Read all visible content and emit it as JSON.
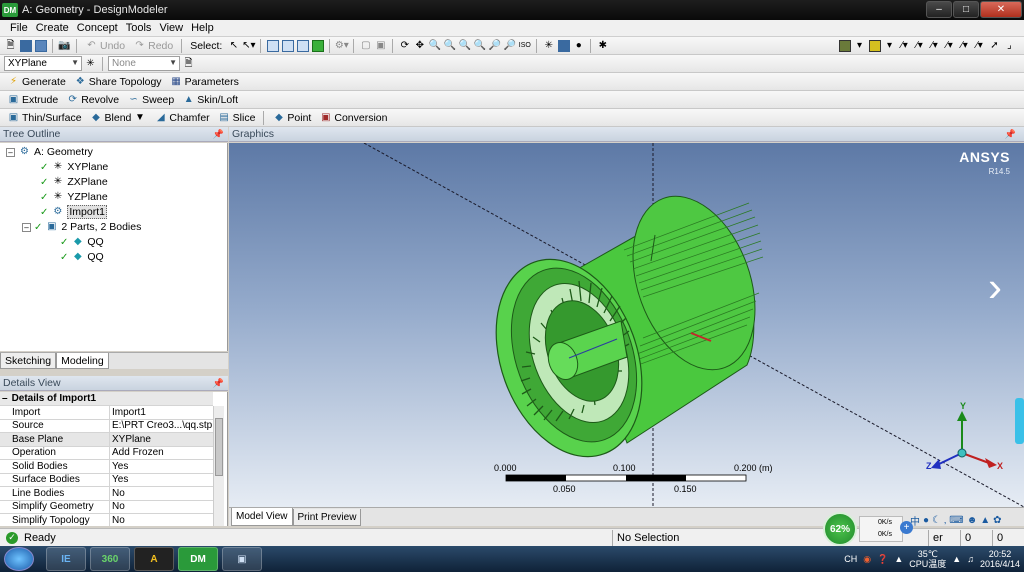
{
  "window": {
    "title": "A: Geometry - DesignModeler",
    "logo": "DM",
    "controls": [
      "–",
      "□",
      "✕"
    ]
  },
  "menu": [
    "File",
    "Create",
    "Concept",
    "Tools",
    "View",
    "Help"
  ],
  "toolbar1": {
    "undo": "Undo",
    "redo": "Redo",
    "select_label": "Select:"
  },
  "toolbar2": {
    "plane_combo": "XYPlane",
    "sketch_combo": "None"
  },
  "toolbar3": {
    "generate": "Generate",
    "share_topology": "Share Topology",
    "parameters": "Parameters"
  },
  "toolbar4": {
    "extrude": "Extrude",
    "revolve": "Revolve",
    "sweep": "Sweep",
    "skin_loft": "Skin/Loft"
  },
  "toolbar5": {
    "thin_surface": "Thin/Surface",
    "blend": "Blend",
    "chamfer": "Chamfer",
    "slice": "Slice",
    "point": "Point",
    "conversion": "Conversion"
  },
  "tree": {
    "header": "Tree Outline",
    "root": "A: Geometry",
    "planes": [
      "XYPlane",
      "ZXPlane",
      "YZPlane"
    ],
    "import": "Import1",
    "parts": "2 Parts, 2 Bodies",
    "bodies": [
      "QQ",
      "QQ"
    ]
  },
  "panel_tabs": [
    "Sketching",
    "Modeling"
  ],
  "details": {
    "header": "Details View",
    "section": "Details of Import1",
    "rows": [
      {
        "k": "Import",
        "v": "Import1"
      },
      {
        "k": "Source",
        "v": "E:\\PRT Creo3...\\qq.stp"
      },
      {
        "k": "Base Plane",
        "v": "XYPlane"
      },
      {
        "k": "Operation",
        "v": "Add Frozen"
      },
      {
        "k": "Solid Bodies",
        "v": "Yes"
      },
      {
        "k": "Surface Bodies",
        "v": "Yes"
      },
      {
        "k": "Line Bodies",
        "v": "No"
      },
      {
        "k": "Simplify Geometry",
        "v": "No"
      },
      {
        "k": "Simplify Topology",
        "v": "No"
      }
    ]
  },
  "graphics": {
    "header": "Graphics",
    "brand": "ANSYS",
    "version": "R14.5",
    "scale_top": [
      "0.000",
      "0.100",
      "0.200 (m)"
    ],
    "scale_bottom": [
      "0.050",
      "0.150"
    ],
    "axes": {
      "x": "X",
      "y": "Y",
      "z": "Z"
    },
    "model_color": "#56d24a",
    "bg_top": "#5d79a6"
  },
  "graphics_tabs": [
    "Model View",
    "Print Preview"
  ],
  "status": {
    "ready": "Ready",
    "selection": "No Selection",
    "unit": "er",
    "val1": "0",
    "val2": "0"
  },
  "net": {
    "percent": "62%",
    "up": "0K/s",
    "down": "0K/s"
  },
  "tray": {
    "lang": "中",
    "cn": "CH",
    "temp": "35℃",
    "cpu": "CPU温度",
    "time": "20:52",
    "date": "2016/4/14"
  },
  "taskbar_apps": [
    "IE",
    "360",
    "A",
    "DM",
    "▣"
  ]
}
